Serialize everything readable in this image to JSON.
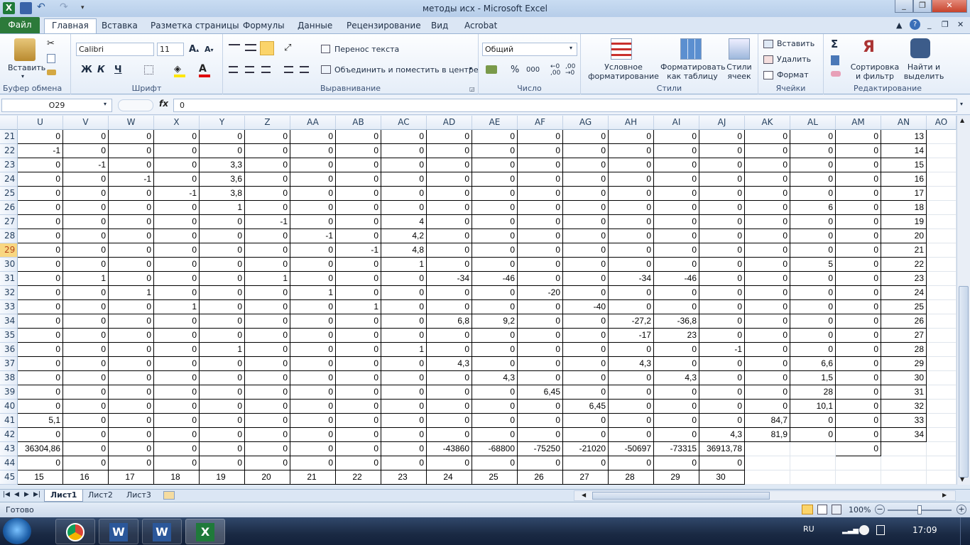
{
  "window": {
    "title": "методы исх - Microsoft Excel"
  },
  "ribbon_tabs": [
    "Главная",
    "Вставка",
    "Разметка страницы",
    "Формулы",
    "Данные",
    "Рецензирование",
    "Вид",
    "Acrobat"
  ],
  "file_tab": "Файл",
  "clipboard": {
    "paste": "Вставить",
    "group": "Буфер обмена"
  },
  "font": {
    "name": "Calibri",
    "size": "11",
    "group": "Шрифт",
    "bold": "Ж",
    "italic": "К",
    "underline": "Ч"
  },
  "alignment": {
    "wrap": "Перенос текста",
    "merge": "Объединить и поместить в центре",
    "group": "Выравнивание"
  },
  "number": {
    "format": "Общий",
    "group": "Число",
    "percent": "%",
    "thousands": "000"
  },
  "styles": {
    "conditional": "Условное форматирование",
    "table": "Форматировать как таблицу",
    "cellstyles": "Стили ячеек",
    "group": "Стили"
  },
  "cells": {
    "insert": "Вставить",
    "delete": "Удалить",
    "format": "Формат",
    "group": "Ячейки"
  },
  "editing": {
    "sort": "Сортировка и фильтр",
    "find": "Найти и выделить",
    "group": "Редактирование"
  },
  "formula_bar": {
    "name_box": "O29",
    "fx": "fx",
    "value": "0"
  },
  "columns": [
    "U",
    "V",
    "W",
    "X",
    "Y",
    "Z",
    "AA",
    "AB",
    "AC",
    "AD",
    "AE",
    "AF",
    "AG",
    "AH",
    "AI",
    "AJ",
    "AK",
    "AL",
    "AM",
    "AN",
    "AO"
  ],
  "rows": [
    {
      "n": "21",
      "cells": [
        "0",
        "0",
        "0",
        "0",
        "0",
        "0",
        "0",
        "0",
        "0",
        "0",
        "0",
        "0",
        "0",
        "0",
        "0",
        "0",
        "0",
        "0",
        "0",
        "13"
      ]
    },
    {
      "n": "22",
      "cells": [
        "-1",
        "0",
        "0",
        "0",
        "0",
        "0",
        "0",
        "0",
        "0",
        "0",
        "0",
        "0",
        "0",
        "0",
        "0",
        "0",
        "0",
        "0",
        "0",
        "14"
      ]
    },
    {
      "n": "23",
      "cells": [
        "0",
        "-1",
        "0",
        "0",
        "3,3",
        "0",
        "0",
        "0",
        "0",
        "0",
        "0",
        "0",
        "0",
        "0",
        "0",
        "0",
        "0",
        "0",
        "0",
        "15"
      ]
    },
    {
      "n": "24",
      "cells": [
        "0",
        "0",
        "-1",
        "0",
        "3,6",
        "0",
        "0",
        "0",
        "0",
        "0",
        "0",
        "0",
        "0",
        "0",
        "0",
        "0",
        "0",
        "0",
        "0",
        "16"
      ]
    },
    {
      "n": "25",
      "cells": [
        "0",
        "0",
        "0",
        "-1",
        "3,8",
        "0",
        "0",
        "0",
        "0",
        "0",
        "0",
        "0",
        "0",
        "0",
        "0",
        "0",
        "0",
        "0",
        "0",
        "17"
      ]
    },
    {
      "n": "26",
      "cells": [
        "0",
        "0",
        "0",
        "0",
        "1",
        "0",
        "0",
        "0",
        "0",
        "0",
        "0",
        "0",
        "0",
        "0",
        "0",
        "0",
        "0",
        "6",
        "0",
        "18"
      ]
    },
    {
      "n": "27",
      "cells": [
        "0",
        "0",
        "0",
        "0",
        "0",
        "-1",
        "0",
        "0",
        "4",
        "0",
        "0",
        "0",
        "0",
        "0",
        "0",
        "0",
        "0",
        "0",
        "0",
        "19"
      ]
    },
    {
      "n": "28",
      "cells": [
        "0",
        "0",
        "0",
        "0",
        "0",
        "0",
        "-1",
        "0",
        "4,2",
        "0",
        "0",
        "0",
        "0",
        "0",
        "0",
        "0",
        "0",
        "0",
        "0",
        "20"
      ]
    },
    {
      "n": "29",
      "cells": [
        "0",
        "0",
        "0",
        "0",
        "0",
        "0",
        "0",
        "-1",
        "4,8",
        "0",
        "0",
        "0",
        "0",
        "0",
        "0",
        "0",
        "0",
        "0",
        "0",
        "21"
      ]
    },
    {
      "n": "30",
      "cells": [
        "0",
        "0",
        "0",
        "0",
        "0",
        "0",
        "0",
        "0",
        "1",
        "0",
        "0",
        "0",
        "0",
        "0",
        "0",
        "0",
        "0",
        "5",
        "0",
        "22"
      ]
    },
    {
      "n": "31",
      "cells": [
        "0",
        "1",
        "0",
        "0",
        "0",
        "1",
        "0",
        "0",
        "0",
        "-34",
        "-46",
        "0",
        "0",
        "-34",
        "-46",
        "0",
        "0",
        "0",
        "0",
        "23"
      ]
    },
    {
      "n": "32",
      "cells": [
        "0",
        "0",
        "1",
        "0",
        "0",
        "0",
        "1",
        "0",
        "0",
        "0",
        "0",
        "-20",
        "0",
        "0",
        "0",
        "0",
        "0",
        "0",
        "0",
        "24"
      ]
    },
    {
      "n": "33",
      "cells": [
        "0",
        "0",
        "0",
        "1",
        "0",
        "0",
        "0",
        "1",
        "0",
        "0",
        "0",
        "0",
        "-40",
        "0",
        "0",
        "0",
        "0",
        "0",
        "0",
        "25"
      ]
    },
    {
      "n": "34",
      "cells": [
        "0",
        "0",
        "0",
        "0",
        "0",
        "0",
        "0",
        "0",
        "0",
        "6,8",
        "9,2",
        "0",
        "0",
        "-27,2",
        "-36,8",
        "0",
        "0",
        "0",
        "0",
        "26"
      ]
    },
    {
      "n": "35",
      "cells": [
        "0",
        "0",
        "0",
        "0",
        "0",
        "0",
        "0",
        "0",
        "0",
        "0",
        "0",
        "0",
        "0",
        "-17",
        "23",
        "0",
        "0",
        "0",
        "0",
        "27"
      ]
    },
    {
      "n": "36",
      "cells": [
        "0",
        "0",
        "0",
        "0",
        "1",
        "0",
        "0",
        "0",
        "1",
        "0",
        "0",
        "0",
        "0",
        "0",
        "0",
        "-1",
        "0",
        "0",
        "0",
        "28"
      ]
    },
    {
      "n": "37",
      "cells": [
        "0",
        "0",
        "0",
        "0",
        "0",
        "0",
        "0",
        "0",
        "0",
        "4,3",
        "0",
        "0",
        "0",
        "4,3",
        "0",
        "0",
        "0",
        "6,6",
        "0",
        "29"
      ]
    },
    {
      "n": "38",
      "cells": [
        "0",
        "0",
        "0",
        "0",
        "0",
        "0",
        "0",
        "0",
        "0",
        "0",
        "4,3",
        "0",
        "0",
        "0",
        "4,3",
        "0",
        "0",
        "1,5",
        "0",
        "30"
      ]
    },
    {
      "n": "39",
      "cells": [
        "0",
        "0",
        "0",
        "0",
        "0",
        "0",
        "0",
        "0",
        "0",
        "0",
        "0",
        "6,45",
        "0",
        "0",
        "0",
        "0",
        "0",
        "28",
        "0",
        "31"
      ]
    },
    {
      "n": "40",
      "cells": [
        "0",
        "0",
        "0",
        "0",
        "0",
        "0",
        "0",
        "0",
        "0",
        "0",
        "0",
        "0",
        "6,45",
        "0",
        "0",
        "0",
        "0",
        "10,1",
        "0",
        "32"
      ]
    },
    {
      "n": "41",
      "cells": [
        "5,1",
        "0",
        "0",
        "0",
        "0",
        "0",
        "0",
        "0",
        "0",
        "0",
        "0",
        "0",
        "0",
        "0",
        "0",
        "0",
        "84,7",
        "0",
        "0",
        "33"
      ]
    },
    {
      "n": "42",
      "cells": [
        "0",
        "0",
        "0",
        "0",
        "0",
        "0",
        "0",
        "0",
        "0",
        "0",
        "0",
        "0",
        "0",
        "0",
        "0",
        "4,3",
        "81,9",
        "0",
        "0",
        "34"
      ]
    },
    {
      "n": "43",
      "cells": [
        "36304,86",
        "0",
        "0",
        "0",
        "0",
        "0",
        "0",
        "0",
        "0",
        "-43860",
        "-68800",
        "-75250",
        "-21020",
        "-50697",
        "-73315",
        "36913,78",
        "",
        "",
        "0",
        ""
      ]
    },
    {
      "n": "44",
      "cells": [
        "0",
        "0",
        "0",
        "0",
        "0",
        "0",
        "0",
        "0",
        "0",
        "0",
        "0",
        "0",
        "0",
        "0",
        "0",
        "0",
        "",
        "",
        "",
        ""
      ]
    },
    {
      "n": "45",
      "cells": [
        "15",
        "16",
        "17",
        "18",
        "19",
        "20",
        "21",
        "22",
        "23",
        "24",
        "25",
        "26",
        "27",
        "28",
        "29",
        "30",
        "",
        "",
        "",
        ""
      ]
    }
  ],
  "selected_row": "29",
  "sheets": [
    "Лист1",
    "Лист2",
    "Лист3"
  ],
  "status": {
    "ready": "Готово",
    "zoom": "100%"
  },
  "taskbar": {
    "lang": "RU",
    "time": "17:09"
  }
}
